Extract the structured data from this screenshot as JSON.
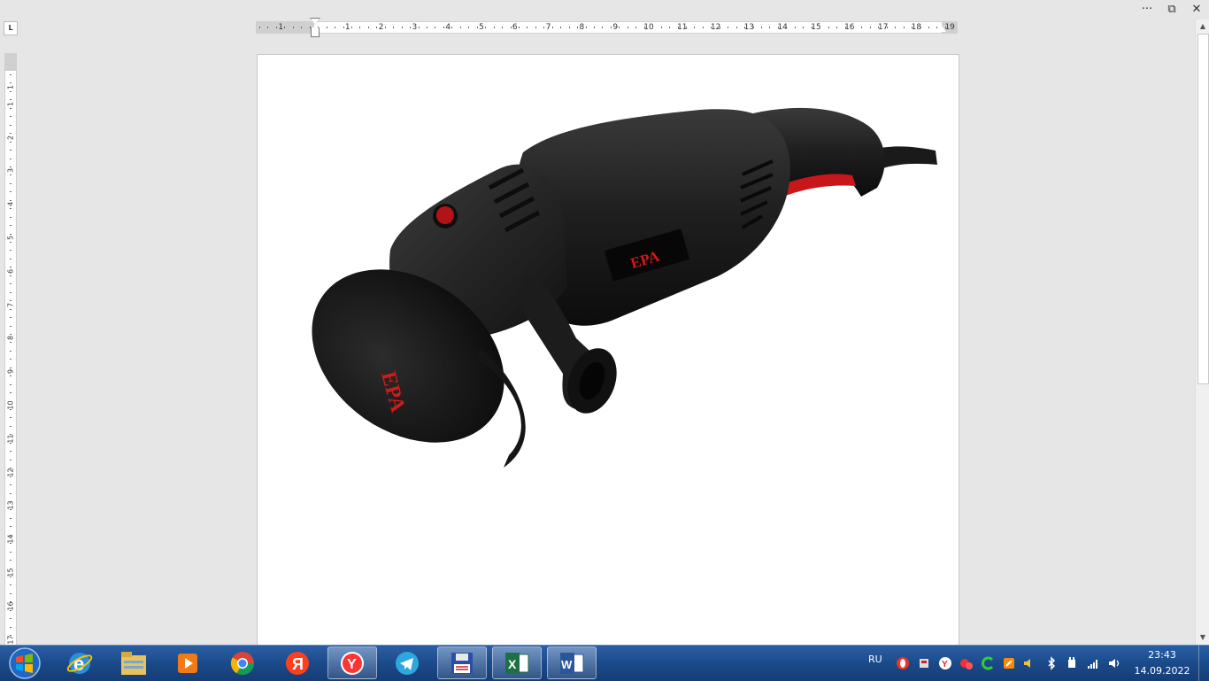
{
  "window": {
    "controls": {
      "more": "···",
      "restore": "⧉",
      "close": "✕"
    }
  },
  "ruler": {
    "tab_selector": "L",
    "horizontal": [
      "1",
      "1",
      "2",
      "3",
      "4",
      "5",
      "6",
      "7",
      "8",
      "9",
      "10",
      "11",
      "12",
      "13",
      "14",
      "15",
      "16",
      "17",
      "18",
      "19"
    ],
    "vertical": [
      "1",
      "1",
      "2",
      "3",
      "4",
      "5",
      "6",
      "7",
      "8",
      "9",
      "10",
      "11",
      "12",
      "13",
      "14",
      "15",
      "16",
      "17"
    ]
  },
  "document": {
    "image": {
      "brand": "EPA",
      "description_icon": "angle-grinder-image"
    }
  },
  "taskbar": {
    "apps": [
      {
        "name": "internet-explorer-icon"
      },
      {
        "name": "file-explorer-icon"
      },
      {
        "name": "media-player-icon"
      },
      {
        "name": "chrome-icon"
      },
      {
        "name": "yandex-icon"
      },
      {
        "name": "yandex-browser-icon"
      },
      {
        "name": "telegram-icon"
      },
      {
        "name": "save-floppy-icon"
      },
      {
        "name": "excel-icon"
      },
      {
        "name": "word-icon"
      }
    ],
    "language": "RU",
    "time": "23:43",
    "date": "14.09.2022"
  },
  "colors": {
    "taskbar": "#1b4a8a",
    "accent_red": "#d11a1a",
    "excel": "#1d7044",
    "word": "#2b579a"
  }
}
